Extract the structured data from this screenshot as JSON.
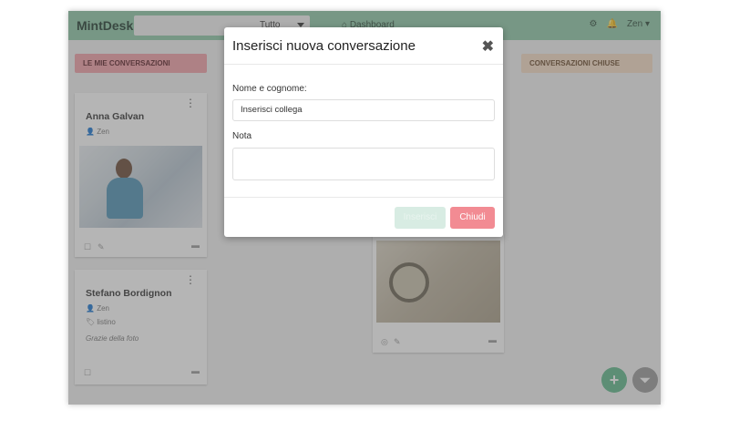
{
  "topbar": {
    "brand": "MintDesk",
    "filter_value": "Tutto",
    "dashboard_link": "Dashboard",
    "user_name": "Zen",
    "icons": [
      "gear-icon",
      "bell-icon",
      "home-icon"
    ]
  },
  "columns": {
    "mine_title": "LE MIE CONVERSAZIONI",
    "closed_title": "CONVERSAZIONI CHIUSE"
  },
  "cards": [
    {
      "name": "Anna Galvan",
      "user": "Zen"
    },
    {
      "name": "Stefano Bordignon",
      "user": "Zen",
      "tag": "listino",
      "note": "Grazie della foto"
    }
  ],
  "modal": {
    "title": "Inserisci nuova conversazione",
    "close_symbol": "✖",
    "name_label": "Nome e cognome:",
    "name_value": "Inserisci collega",
    "note_label": "Nota",
    "note_value": "",
    "save_label": "Inserisci",
    "close_label": "Chiudi"
  },
  "colors": {
    "topbar": "#8fc9a8",
    "mine_header": "#f2a0a8",
    "closed_header": "#f6dcc5",
    "close_button": "#f28b93",
    "fab_add": "#5fb98a",
    "fab_filter": "#9a9a9a"
  }
}
